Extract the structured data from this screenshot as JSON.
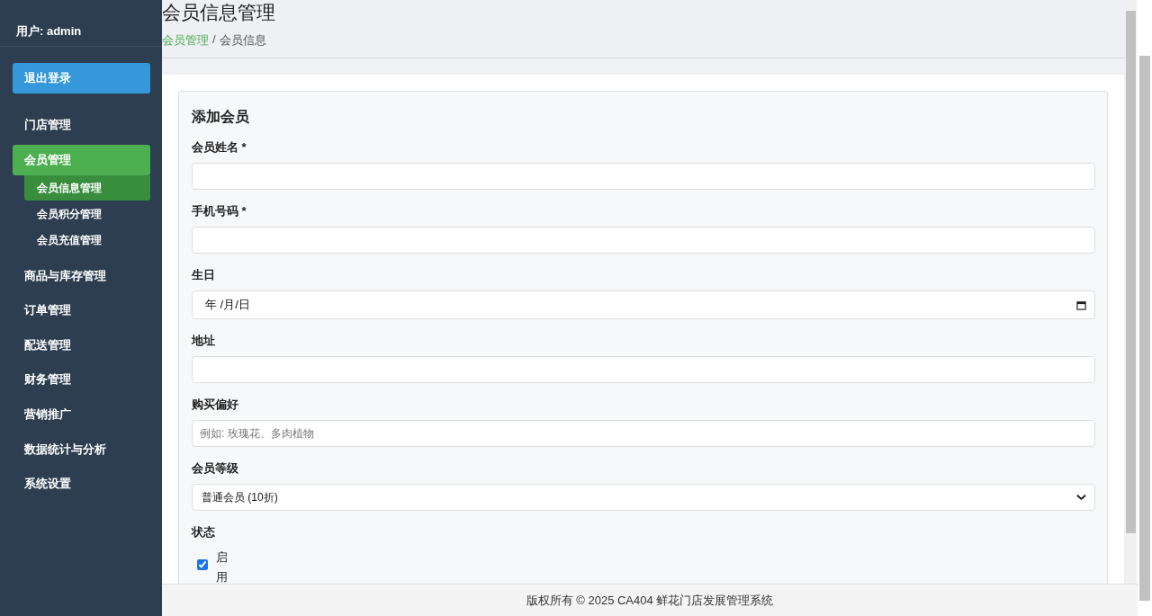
{
  "sidebar": {
    "user": "用户: admin",
    "logout": "退出登录",
    "items": [
      {
        "label": "门店管理",
        "selected": false
      },
      {
        "label": "会员管理",
        "selected": true,
        "children": [
          {
            "label": "会员信息管理",
            "selected": true
          },
          {
            "label": "会员积分管理",
            "selected": false
          },
          {
            "label": "会员充值管理",
            "selected": false
          }
        ]
      },
      {
        "label": "商品与库存管理",
        "selected": false
      },
      {
        "label": "订单管理",
        "selected": false
      },
      {
        "label": "配送管理",
        "selected": false
      },
      {
        "label": "财务管理",
        "selected": false
      },
      {
        "label": "营销推广",
        "selected": false
      },
      {
        "label": "数据统计与分析",
        "selected": false
      },
      {
        "label": "系统设置",
        "selected": false
      }
    ]
  },
  "header": {
    "title": "会员信息管理",
    "breadcrumb": [
      {
        "label": "会员管理",
        "kind": "link"
      },
      {
        "label": "/",
        "kind": "separator"
      },
      {
        "label": "会员信息",
        "kind": "current"
      }
    ]
  },
  "form": {
    "title": "添加会员",
    "fields": [
      {
        "kind": "text",
        "label": "会员姓名 *"
      },
      {
        "kind": "text",
        "label": "手机号码 *"
      },
      {
        "kind": "date",
        "label": "生日",
        "value": "年 /月/日"
      },
      {
        "kind": "text",
        "label": "地址"
      },
      {
        "kind": "text",
        "label": "购买偏好",
        "placeholder": "例如: 玫瑰花、多肉植物"
      },
      {
        "kind": "select",
        "label": "会员等级",
        "value": "普通会员 (10折)"
      },
      {
        "kind": "checkbox",
        "label": "状态",
        "option": "启用",
        "checked": true
      }
    ]
  },
  "footer": "版权所有 © 2025 CA404 鲜花门店发展管理系统"
}
